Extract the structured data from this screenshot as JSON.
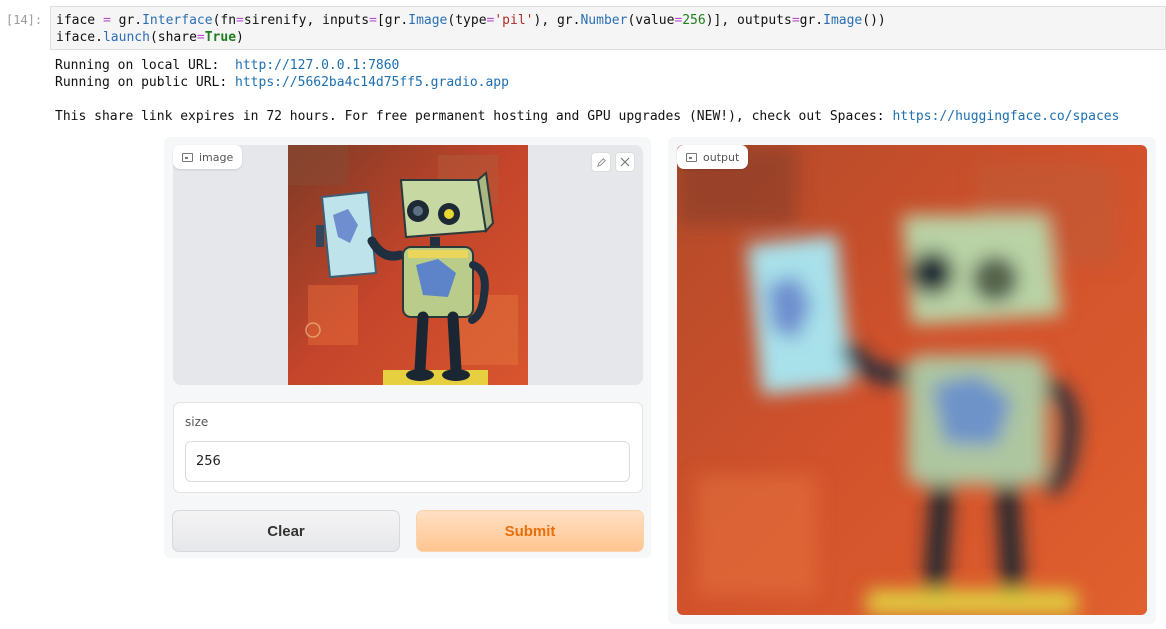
{
  "cell": {
    "prompt": "[14]:",
    "code_line1": [
      {
        "t": "iface ",
        "c": ""
      },
      {
        "t": "=",
        "c": "kw"
      },
      {
        "t": " gr.",
        "c": ""
      },
      {
        "t": "Interface",
        "c": "fn"
      },
      {
        "t": "(fn",
        "c": ""
      },
      {
        "t": "=",
        "c": "kw"
      },
      {
        "t": "sirenify, inputs",
        "c": ""
      },
      {
        "t": "=",
        "c": "kw"
      },
      {
        "t": "[gr.",
        "c": ""
      },
      {
        "t": "Image",
        "c": "fn"
      },
      {
        "t": "(type",
        "c": ""
      },
      {
        "t": "=",
        "c": "kw"
      },
      {
        "t": "'pil'",
        "c": "str"
      },
      {
        "t": "), gr.",
        "c": ""
      },
      {
        "t": "Number",
        "c": "fn"
      },
      {
        "t": "(value",
        "c": ""
      },
      {
        "t": "=",
        "c": "kw"
      },
      {
        "t": "256",
        "c": "num"
      },
      {
        "t": ")], outputs",
        "c": ""
      },
      {
        "t": "=",
        "c": "kw"
      },
      {
        "t": "gr.",
        "c": ""
      },
      {
        "t": "Image",
        "c": "fn"
      },
      {
        "t": "())",
        "c": ""
      }
    ],
    "code_line2": [
      {
        "t": "iface.",
        "c": ""
      },
      {
        "t": "launch",
        "c": "fn"
      },
      {
        "t": "(share",
        "c": ""
      },
      {
        "t": "=",
        "c": "kw"
      },
      {
        "t": "True",
        "c": "bool"
      },
      {
        "t": ")",
        "c": ""
      }
    ]
  },
  "output": {
    "local_prefix": "Running on local URL:  ",
    "local_url": "http://127.0.0.1:7860",
    "public_prefix": "Running on public URL: ",
    "public_url": "https://5662ba4c14d75ff5.gradio.app",
    "share_text": "This share link expires in 72 hours. For free permanent hosting and GPU upgrades (NEW!), check out Spaces: ",
    "spaces_url": "https://huggingface.co/spaces"
  },
  "gradio": {
    "input_image_label": "image",
    "output_image_label": "output",
    "edit_icon": "pencil-icon",
    "close_icon": "close-icon",
    "size_label": "size",
    "size_value": "256",
    "clear_label": "Clear",
    "submit_label": "Submit"
  },
  "colors": {
    "submit_text": "#e7700d",
    "link": "#1e6fb0"
  }
}
